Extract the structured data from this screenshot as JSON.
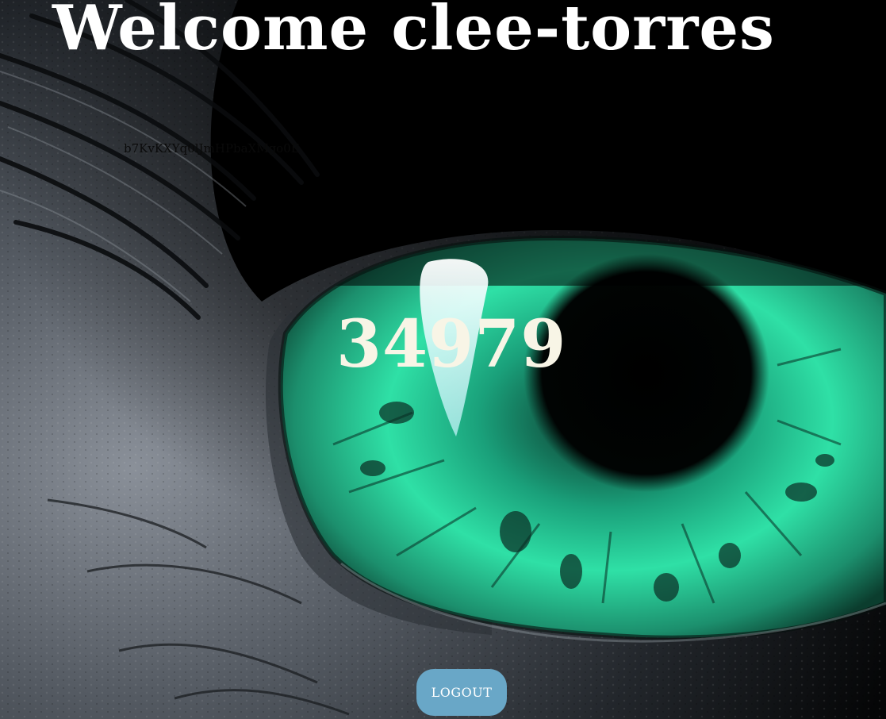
{
  "header": {
    "welcome_text": "Welcome clee-torres"
  },
  "token_text": "b7KvKXYq0lJmHPbaXMgo0E",
  "counter": {
    "value": "34979"
  },
  "logout_button": {
    "label": "LOGOUT",
    "bg_color": "#69a7c7"
  },
  "background": {
    "icon": "eye-photo",
    "iris_color": "#2fe0a6"
  }
}
